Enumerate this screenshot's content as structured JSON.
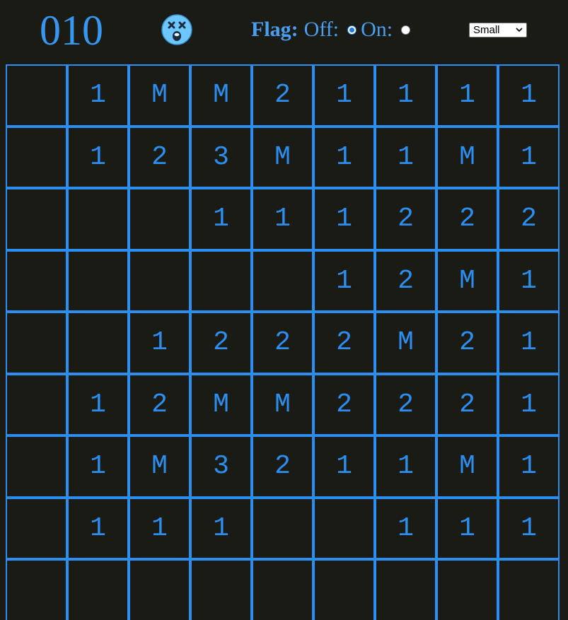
{
  "header": {
    "mine_counter": "010",
    "face": "dizzy-face-icon",
    "flag_label": "Flag:",
    "flag_off_label": "Off:",
    "flag_on_label": "On:",
    "flag_mode": "off",
    "size_select_value": "Small"
  },
  "colors": {
    "background": "#1b1b15",
    "accent": "#2c8ef0",
    "face": "#6ec6ff"
  },
  "board": {
    "rows": [
      [
        "",
        "1",
        "M",
        "M",
        "2",
        "1",
        "1",
        "1",
        "1"
      ],
      [
        "",
        "1",
        "2",
        "3",
        "M",
        "1",
        "1",
        "M",
        "1"
      ],
      [
        "",
        "",
        "",
        "1",
        "1",
        "1",
        "2",
        "2",
        "2"
      ],
      [
        "",
        "",
        "",
        "",
        "",
        "1",
        "2",
        "M",
        "1"
      ],
      [
        "",
        "",
        "1",
        "2",
        "2",
        "2",
        "M",
        "2",
        "1"
      ],
      [
        "",
        "1",
        "2",
        "M",
        "M",
        "2",
        "2",
        "2",
        "1"
      ],
      [
        "",
        "1",
        "M",
        "3",
        "2",
        "1",
        "1",
        "M",
        "1"
      ],
      [
        "",
        "1",
        "1",
        "1",
        "",
        "",
        "1",
        "1",
        "1"
      ],
      [
        "",
        "",
        "",
        "",
        "",
        "",
        "",
        "",
        ""
      ]
    ]
  }
}
